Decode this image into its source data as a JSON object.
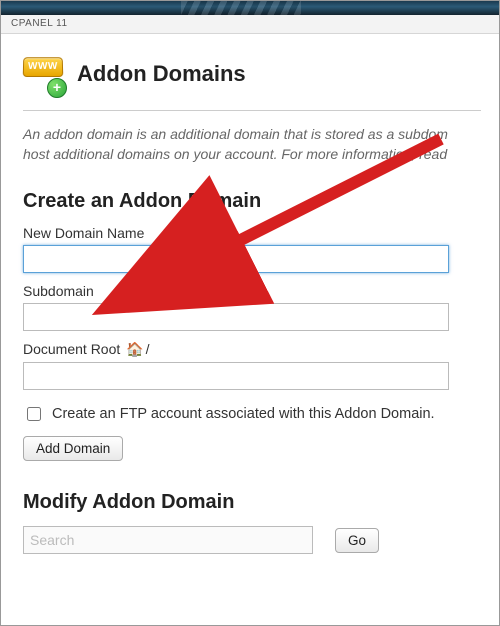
{
  "cpanelbar": {
    "label": "CPANEL 11"
  },
  "header": {
    "icon_www": "WWW",
    "page_title": "Addon Domains"
  },
  "description": "An addon domain is an additional domain that is stored as a subdom\nhost additional domains on your account. For more information, read",
  "sections": {
    "create": {
      "heading": "Create an Addon Domain",
      "new_domain_label": "New Domain Name",
      "new_domain_value": "",
      "subdomain_label": "Subdomain",
      "subdomain_value": "",
      "docroot_label_prefix": "Document Root ",
      "docroot_label_suffix": "/",
      "docroot_value": "",
      "ftp_checkbox_label": "Create an FTP account associated with this Addon Domain.",
      "ftp_checked": false,
      "submit_label": "Add Domain"
    },
    "modify": {
      "heading": "Modify Addon Domain",
      "search_placeholder": "Search",
      "search_value": "",
      "go_label": "Go"
    }
  }
}
